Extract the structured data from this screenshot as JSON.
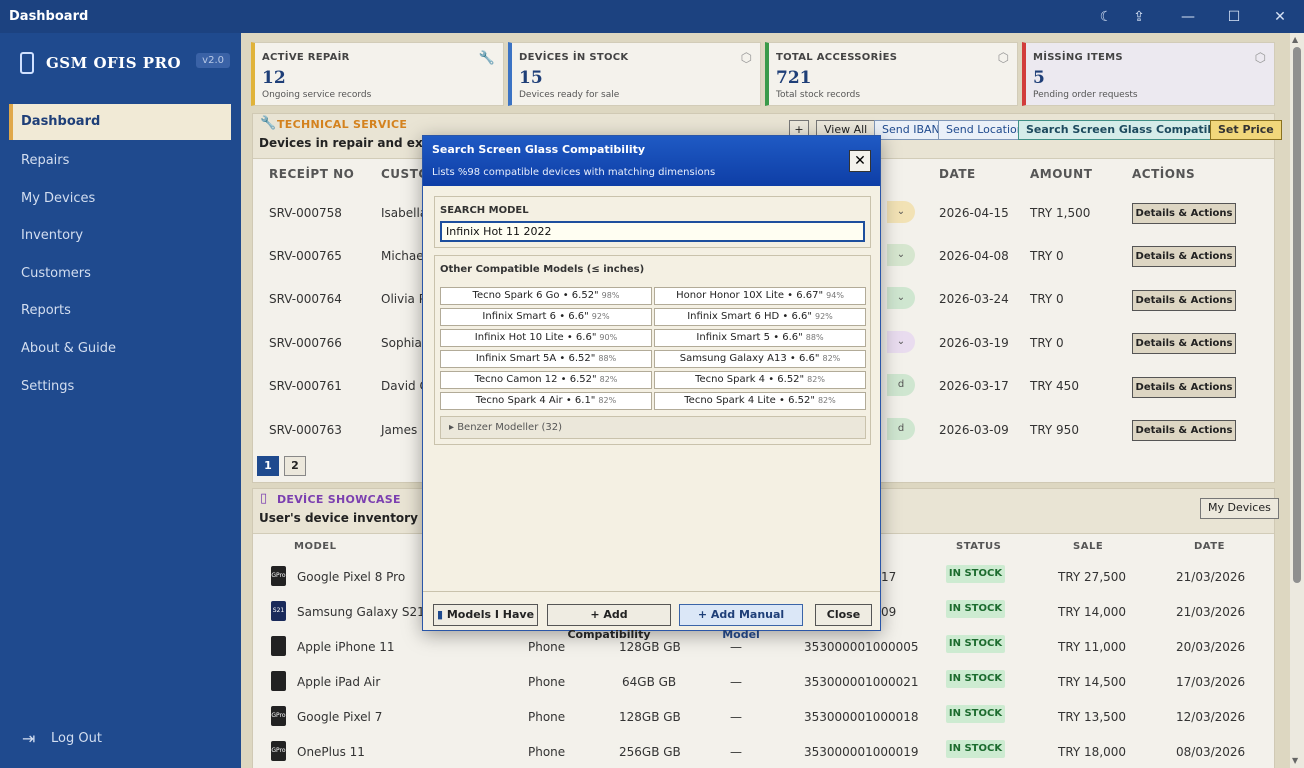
{
  "window": {
    "title": "Dashboard",
    "controls": [
      "moon-icon",
      "upload-icon",
      "minimize-icon",
      "maximize-icon",
      "close-icon"
    ]
  },
  "sidebar": {
    "brand": "GSM OFIS PRO",
    "version": "v2.0",
    "items": [
      {
        "label": "Dashboard",
        "active": true
      },
      {
        "label": "Repairs"
      },
      {
        "label": "My Devices"
      },
      {
        "label": "Inventory"
      },
      {
        "label": "Customers"
      },
      {
        "label": "Reports"
      },
      {
        "label": "About & Guide"
      },
      {
        "label": "Settings"
      }
    ],
    "logout": "Log Out"
  },
  "stats": [
    {
      "label": "ACTİVE REPAİR",
      "value": "12",
      "sub": "Ongoing service records",
      "color": "#e0b33a"
    },
    {
      "label": "DEVİCES İN STOCK",
      "value": "15",
      "sub": "Devices ready for sale",
      "color": "#3b73c4"
    },
    {
      "label": "TOTAL ACCESSORİES",
      "value": "721",
      "sub": "Total stock records",
      "color": "#3a9a4a"
    },
    {
      "label": "MİSSİNG ITEMS",
      "value": "5",
      "sub": "Pending order requests",
      "color": "#d23c3c"
    }
  ],
  "technical": {
    "title": "TECHNICAL SERVICE",
    "subtitle": "Devices in repair and express",
    "buttons": {
      "plus": "+",
      "view_all": "View All",
      "send_iban": "Send IBAN",
      "send_location": "Send Location",
      "search_glass": "Search Screen Glass Compatibility",
      "set_price": "Set Price"
    },
    "headers": {
      "receipt": "RECEİPT NO",
      "customer": "CUSTO",
      "date": "DATE",
      "amount": "AMOUNT",
      "actions": "ACTİONS"
    },
    "rows": [
      {
        "receipt": "SRV-000758",
        "customer": "Isabella",
        "date": "2026-04-15",
        "amount": "TRY 1,500",
        "action": "Details & Actions"
      },
      {
        "receipt": "SRV-000765",
        "customer": "Michael",
        "date": "2026-04-08",
        "amount": "TRY 0",
        "action": "Details & Actions"
      },
      {
        "receipt": "SRV-000764",
        "customer": "Olivia P",
        "date": "2026-03-24",
        "amount": "TRY 0",
        "action": "Details & Actions"
      },
      {
        "receipt": "SRV-000766",
        "customer": "Sophia",
        "date": "2026-03-19",
        "amount": "TRY 0",
        "action": "Details & Actions"
      },
      {
        "receipt": "SRV-000761",
        "customer": "David C",
        "date": "2026-03-17",
        "amount": "TRY 450",
        "action": "Details & Actions"
      },
      {
        "receipt": "SRV-000763",
        "customer": "James I",
        "date": "2026-03-09",
        "amount": "TRY 950",
        "action": "Details & Actions"
      }
    ],
    "pages": [
      "1",
      "2"
    ]
  },
  "showcase": {
    "title": "DEVİCE SHOWCASE",
    "subtitle": "User's device inventory",
    "my_devices_button": "My Devices",
    "headers": {
      "model": "MODEL",
      "status": "STATUS",
      "sale": "SALE",
      "date": "DATE"
    },
    "rows": [
      {
        "model": "Google Pixel 8 Pro",
        "type": "",
        "storage": "",
        "dash": "",
        "imei": "17",
        "status": "IN STOCK",
        "sale": "TRY 27,500",
        "date": "21/03/2026"
      },
      {
        "model": "Samsung Galaxy S21",
        "type": "",
        "storage": "",
        "dash": "",
        "imei": "09",
        "status": "IN STOCK",
        "sale": "TRY 14,000",
        "date": "21/03/2026"
      },
      {
        "model": "Apple iPhone 11",
        "type": "Phone",
        "storage": "128GB GB",
        "dash": "—",
        "imei": "353000001000005",
        "status": "IN STOCK",
        "sale": "TRY 11,000",
        "date": "20/03/2026"
      },
      {
        "model": "Apple iPad Air",
        "type": "Phone",
        "storage": "64GB GB",
        "dash": "—",
        "imei": "353000001000021",
        "status": "IN STOCK",
        "sale": "TRY 14,500",
        "date": "17/03/2026"
      },
      {
        "model": "Google Pixel 7",
        "type": "Phone",
        "storage": "128GB GB",
        "dash": "—",
        "imei": "353000001000018",
        "status": "IN STOCK",
        "sale": "TRY 13,500",
        "date": "12/03/2026"
      },
      {
        "model": "OnePlus 11",
        "type": "Phone",
        "storage": "256GB GB",
        "dash": "—",
        "imei": "353000001000019",
        "status": "IN STOCK",
        "sale": "TRY 18,000",
        "date": "08/03/2026"
      }
    ]
  },
  "dialog": {
    "title": "Search Screen Glass Compatibility",
    "subtitle": "Lists %98 compatible devices with matching dimensions",
    "search_label": "SEARCH MODEL",
    "search_value": "Infinix Hot 11 2022",
    "compatible_label": "Other Compatible Models (≤ inches)",
    "models": [
      {
        "name": "Tecno Spark 6 Go • 6.52\"",
        "pct": "98%"
      },
      {
        "name": "Honor Honor 10X Lite • 6.67\"",
        "pct": "94%"
      },
      {
        "name": "Infinix Smart 6 • 6.6\"",
        "pct": "92%"
      },
      {
        "name": "Infinix Smart 6 HD • 6.6\"",
        "pct": "92%"
      },
      {
        "name": "Infinix Hot 10 Lite • 6.6\"",
        "pct": "90%"
      },
      {
        "name": "Infinix Smart 5 • 6.6\"",
        "pct": "88%"
      },
      {
        "name": "Infinix Smart 5A • 6.52\"",
        "pct": "88%"
      },
      {
        "name": "Samsung Galaxy A13 • 6.6\"",
        "pct": "82%"
      },
      {
        "name": "Tecno Camon 12 • 6.52\"",
        "pct": "82%"
      },
      {
        "name": "Tecno Spark 4 • 6.52\"",
        "pct": "82%"
      },
      {
        "name": "Tecno Spark 4 Air • 6.1\"",
        "pct": "82%"
      },
      {
        "name": "Tecno Spark 4 Lite • 6.52\"",
        "pct": "82%"
      }
    ],
    "similar": "▸ Benzer Modeller (32)",
    "buttons": {
      "models_i_have": "Models I Have",
      "add_compat": "+ Add Compatibility",
      "add_manual": "+ Add Manual Model",
      "close": "Close"
    }
  }
}
